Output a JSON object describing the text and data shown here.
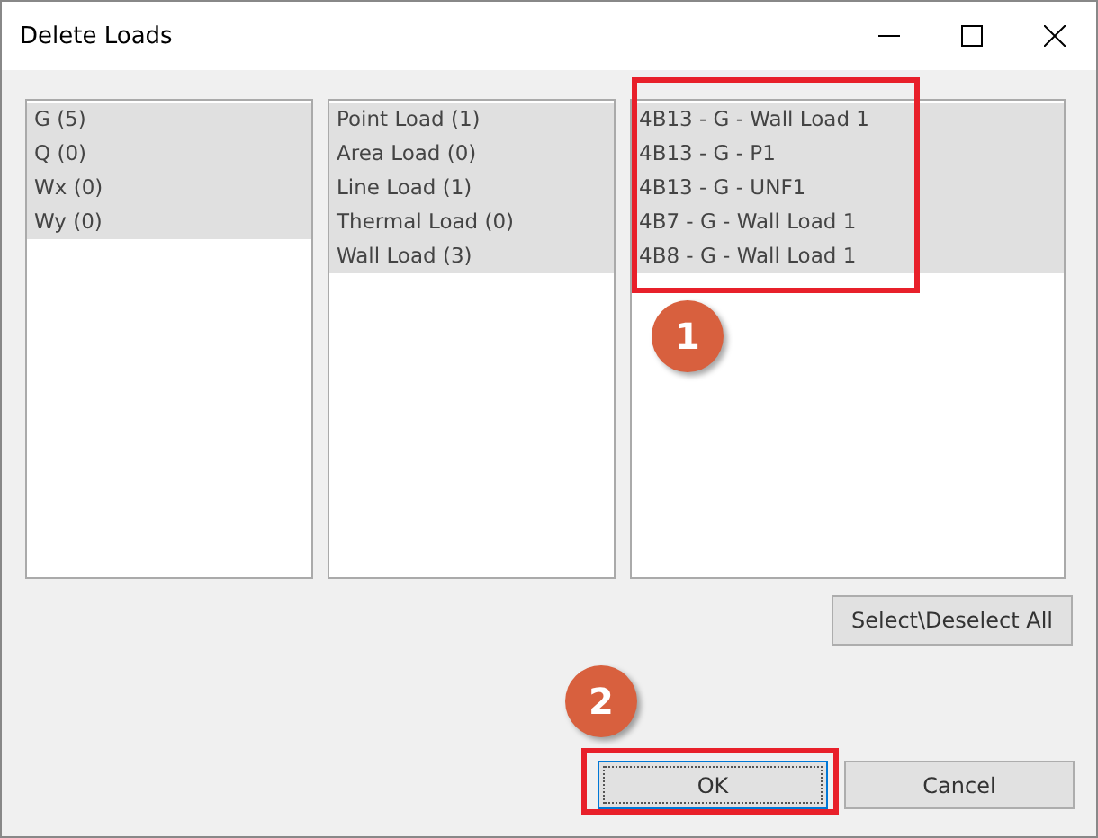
{
  "window": {
    "title": "Delete Loads"
  },
  "lists": [
    {
      "items": [
        {
          "label": "G (5)",
          "selected": true
        },
        {
          "label": "Q (0)",
          "selected": true
        },
        {
          "label": "Wx (0)",
          "selected": true
        },
        {
          "label": "Wy (0)",
          "selected": true
        }
      ]
    },
    {
      "items": [
        {
          "label": "Point Load (1)",
          "selected": true
        },
        {
          "label": "Area Load (0)",
          "selected": true
        },
        {
          "label": "Line Load (1)",
          "selected": true
        },
        {
          "label": "Thermal Load (0)",
          "selected": true
        },
        {
          "label": "Wall Load (3)",
          "selected": true
        }
      ]
    },
    {
      "items": [
        {
          "label": "4B13 - G - Wall Load 1",
          "selected": true
        },
        {
          "label": "4B13 - G - P1",
          "selected": true
        },
        {
          "label": "4B13 - G - UNF1",
          "selected": true
        },
        {
          "label": "4B7 - G - Wall Load 1",
          "selected": true
        },
        {
          "label": "4B8 - G - Wall Load 1",
          "selected": true
        }
      ]
    }
  ],
  "select_all_button": "Select\\Deselect All",
  "buttons": [
    {
      "label": "OK",
      "focused": true
    },
    {
      "label": "Cancel",
      "focused": false
    }
  ],
  "annotations": [
    {
      "label": "1"
    },
    {
      "label": "2"
    }
  ]
}
